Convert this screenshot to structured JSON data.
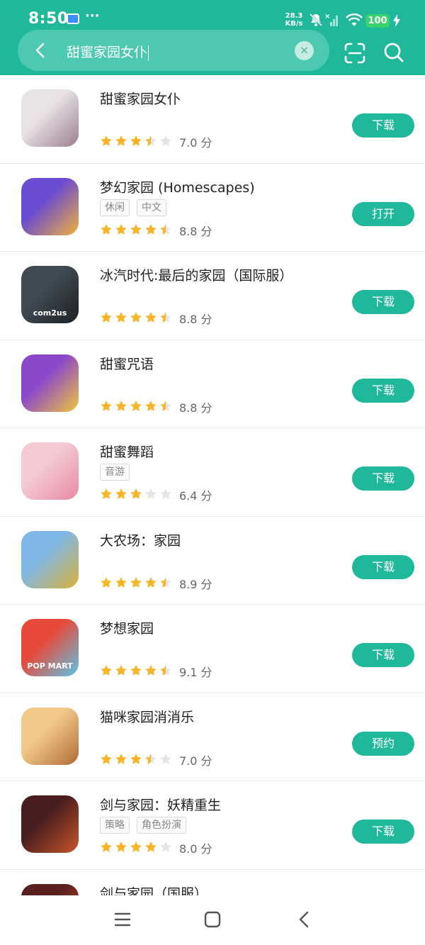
{
  "status_bar": {
    "time": "8:50",
    "dots": "···",
    "speed_value": "28.3",
    "speed_unit": "KB/s",
    "battery": "100"
  },
  "search": {
    "query": "甜蜜家园女仆",
    "clear_symbol": "×"
  },
  "icons": {
    "back": "back-arrow-icon",
    "clear": "clear-icon",
    "scan": "scan-icon",
    "search": "search-icon",
    "star": "star-icon"
  },
  "colors": {
    "accent": "#1fb89a",
    "star": "#f7b52c",
    "star_empty": "#e6e6e6"
  },
  "apps": [
    {
      "name": "甜蜜家园女仆",
      "tags": [],
      "rating": 3.5,
      "score": "7.0 分",
      "action": "下载",
      "icon_colors": [
        "#e9e2e7",
        "#9b7f8c"
      ]
    },
    {
      "name": "梦幻家园 (Homescapes)",
      "tags": [
        "休闲",
        "中文"
      ],
      "rating": 4.5,
      "score": "8.8 分",
      "action": "打开",
      "icon_colors": [
        "#6b4bd1",
        "#f0b23a"
      ]
    },
    {
      "name": "冰汽时代:最后的家园（国际服）",
      "tags": [],
      "rating": 4.5,
      "score": "8.8 分",
      "action": "下载",
      "icon_colors": [
        "#3f4a52",
        "#1c2125"
      ],
      "icon_glyph": "com2us"
    },
    {
      "name": "甜蜜咒语",
      "tags": [],
      "rating": 4.5,
      "score": "8.8 分",
      "action": "下载",
      "icon_colors": [
        "#8b47c9",
        "#f0c63f"
      ]
    },
    {
      "name": "甜蜜舞蹈",
      "tags": [
        "音游"
      ],
      "rating": 3,
      "score": "6.4 分",
      "action": "下载",
      "icon_colors": [
        "#f4c9d3",
        "#e88aa6"
      ]
    },
    {
      "name": "大农场：家园",
      "tags": [],
      "rating": 4.5,
      "score": "8.9 分",
      "action": "下载",
      "icon_colors": [
        "#7fb8e6",
        "#d9b13a"
      ]
    },
    {
      "name": "梦想家园",
      "tags": [],
      "rating": 4.5,
      "score": "9.1 分",
      "action": "下载",
      "icon_colors": [
        "#e74a3b",
        "#5bc5e8"
      ],
      "icon_glyph": "POP MART"
    },
    {
      "name": "猫咪家园消消乐",
      "tags": [],
      "rating": 3.5,
      "score": "7.0 分",
      "action": "预约",
      "icon_colors": [
        "#f2c98a",
        "#b06a35"
      ]
    },
    {
      "name": "剑与家园：妖精重生",
      "tags": [
        "策略",
        "角色扮演"
      ],
      "rating": 4,
      "score": "8.0 分",
      "action": "下载",
      "icon_colors": [
        "#4a1e1e",
        "#c7562c"
      ]
    },
    {
      "name": "剑与家园（国服）",
      "tags": [],
      "rating": null,
      "score": "",
      "action": "",
      "icon_colors": [
        "#5a1f1f",
        "#c7562c"
      ]
    }
  ],
  "nav": {
    "menu": "menu-icon",
    "home": "home-icon",
    "back": "back-icon"
  }
}
